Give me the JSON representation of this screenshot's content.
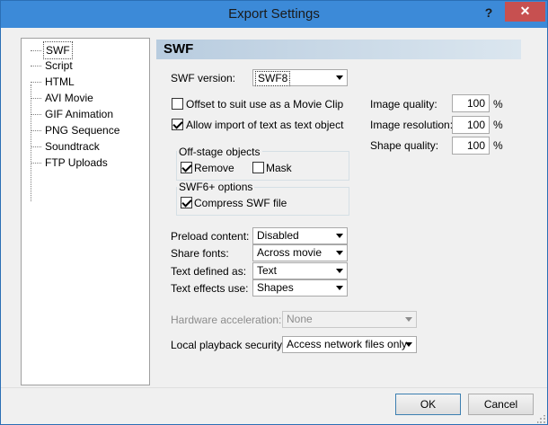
{
  "window": {
    "title": "Export Settings",
    "help_glyph": "?",
    "close_glyph": "✕"
  },
  "nav": {
    "items": [
      "SWF",
      "Script",
      "HTML",
      "AVI Movie",
      "GIF Animation",
      "PNG Sequence",
      "Soundtrack",
      "FTP Uploads"
    ],
    "selected": "SWF"
  },
  "section": {
    "title": "SWF"
  },
  "swf_version": {
    "label": "SWF version:",
    "value": "SWF8"
  },
  "options": {
    "offset_label": "Offset to suit use as a Movie Clip",
    "offset_checked": false,
    "allow_import_label": "Allow import of text as text object",
    "allow_import_checked": true
  },
  "offstage": {
    "title": "Off-stage objects",
    "remove_label": "Remove",
    "remove_checked": true,
    "mask_label": "Mask",
    "mask_checked": false
  },
  "swf6": {
    "title": "SWF6+ options",
    "compress_label": "Compress SWF file",
    "compress_checked": true
  },
  "quality": {
    "image_quality_label": "Image quality:",
    "image_quality": "100",
    "image_resolution_label": "Image resolution:",
    "image_resolution": "100",
    "shape_quality_label": "Shape quality:",
    "shape_quality": "100",
    "unit": "%"
  },
  "settings": {
    "preload_label": "Preload content:",
    "preload_value": "Disabled",
    "share_fonts_label": "Share fonts:",
    "share_fonts_value": "Across movie",
    "text_defined_label": "Text defined as:",
    "text_defined_value": "Text",
    "text_effects_label": "Text effects use:",
    "text_effects_value": "Shapes",
    "hw_accel_label": "Hardware acceleration:",
    "hw_accel_value": "None",
    "local_playback_label": "Local playback security:",
    "local_playback_value": "Access network files only"
  },
  "buttons": {
    "ok": "OK",
    "cancel": "Cancel"
  },
  "colors": {
    "titlebar": "#3c8ad8",
    "close": "#c75050",
    "section_header": "#b8ccdf"
  }
}
